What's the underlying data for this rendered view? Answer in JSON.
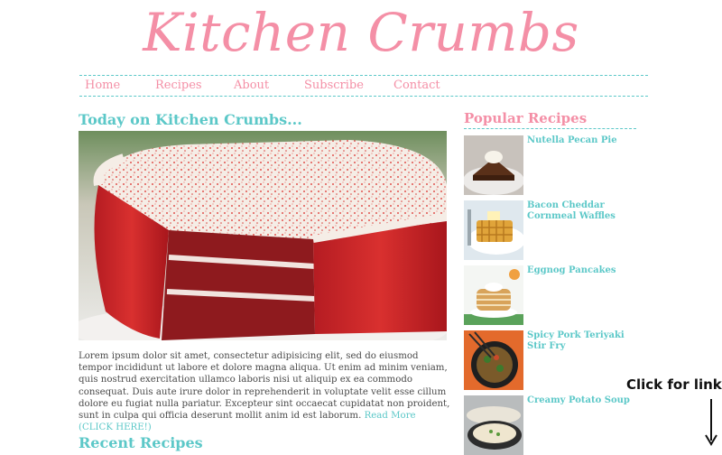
{
  "site": {
    "title": "Kitchen Crumbs"
  },
  "nav": {
    "items": [
      "Home",
      "Recipes",
      "About",
      "Subscribe",
      "Contact"
    ]
  },
  "main": {
    "heading": "Today on Kitchen Crumbs...",
    "hero_image": "red-velvet-cake-photo",
    "body": "Lorem ipsum dolor sit amet, consectetur adipisicing elit, sed do eiusmod tempor incididunt ut labore et dolore magna aliqua. Ut enim ad minim veniam, quis nostrud exercitation ullamco laboris nisi ut aliquip ex ea commodo consequat. Duis aute irure dolor in reprehenderit in voluptate velit esse cillum dolore eu fugiat nulla pariatur. Excepteur sint occaecat cupidatat non proident, sunt in culpa qui officia deserunt mollit anim id est laborum.",
    "read_more": "Read More (CLICK HERE!)",
    "recent_heading": "Recent Recipes"
  },
  "sidebar": {
    "heading": "Popular Recipes",
    "items": [
      {
        "title": "Nutella Pecan Pie",
        "icon": "pie-photo"
      },
      {
        "title": "Bacon Cheddar Cornmeal Waffles",
        "icon": "waffles-photo"
      },
      {
        "title": "Eggnog Pancakes",
        "icon": "pancakes-photo"
      },
      {
        "title": "Spicy Pork Teriyaki Stir Fry",
        "icon": "stir-fry-photo"
      },
      {
        "title": "Creamy Potato Soup",
        "icon": "soup-photo"
      }
    ]
  },
  "annotation": {
    "text": "Click for link"
  },
  "colors": {
    "pink": "#f48fa6",
    "teal": "#5cc8c8",
    "text": "#4a4a4a"
  }
}
